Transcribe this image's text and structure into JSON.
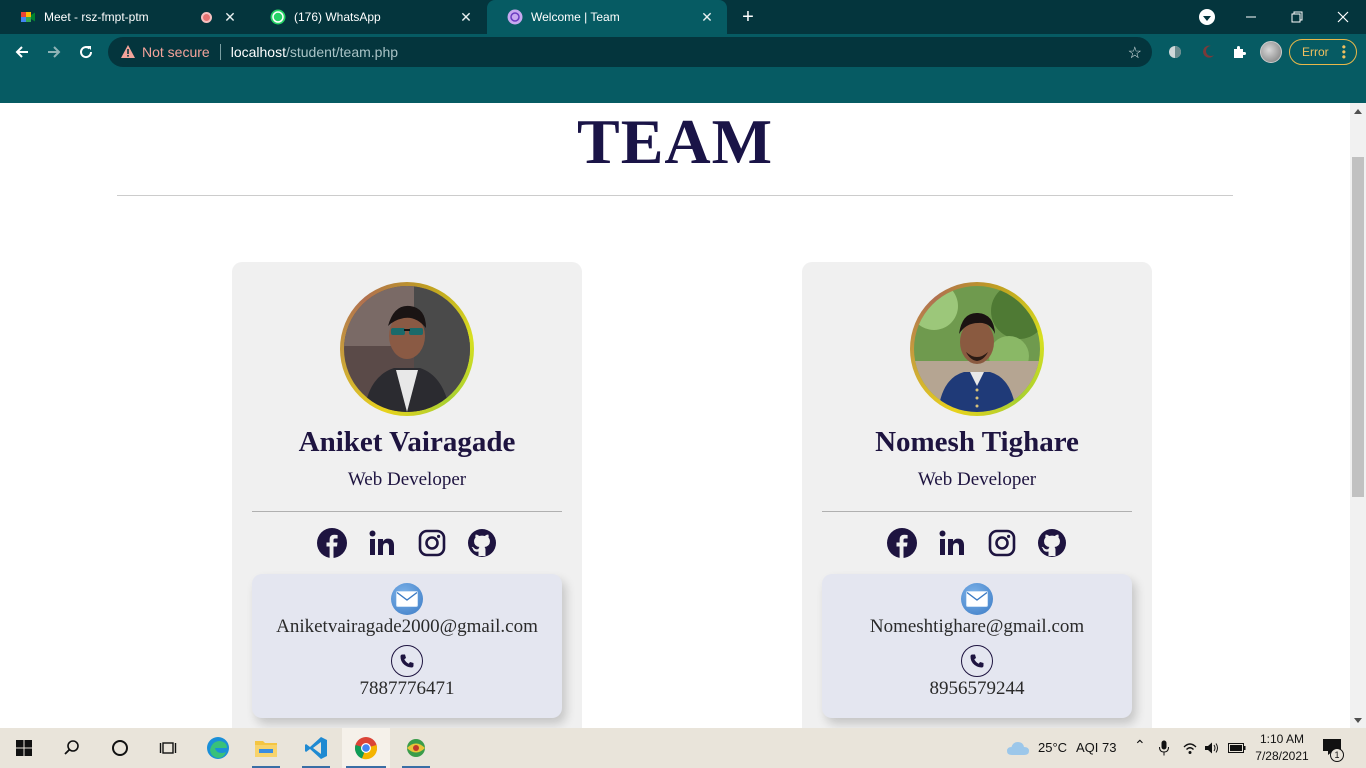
{
  "browser": {
    "tabs": [
      {
        "title": "Meet - rsz-fmpt-ptm",
        "icon": "google-meet-icon",
        "recording": true
      },
      {
        "title": "(176) WhatsApp",
        "icon": "whatsapp-icon"
      },
      {
        "title": "Welcome | Team",
        "icon": "site-icon",
        "active": true
      }
    ],
    "security_label": "Not secure",
    "url_host": "localhost",
    "url_path": "/student/team.php",
    "error_label": "Error"
  },
  "page": {
    "title": "TEAM",
    "members": [
      {
        "name": "Aniket Vairagade",
        "role": "Web Developer",
        "socials": [
          "facebook-icon",
          "linkedin-icon",
          "instagram-icon",
          "github-icon"
        ],
        "email": "Aniketvairagade2000@gmail.com",
        "phone": "7887776471"
      },
      {
        "name": "Nomesh Tighare",
        "role": "Web Developer",
        "socials": [
          "facebook-icon",
          "linkedin-icon",
          "instagram-icon",
          "github-icon"
        ],
        "email": "Nomeshtighare@gmail.com",
        "phone": "8956579244"
      }
    ]
  },
  "taskbar": {
    "weather": "25°C",
    "aqi": "AQI 73",
    "time": "1:10 AM",
    "date": "7/28/2021",
    "notifications": "1"
  },
  "colors": {
    "chrome_dark": "#04353d",
    "chrome_teal": "#065b63",
    "heading": "#1a1447",
    "card_bg": "#f0f0f0",
    "contact_bg": "#e4e6f0"
  }
}
